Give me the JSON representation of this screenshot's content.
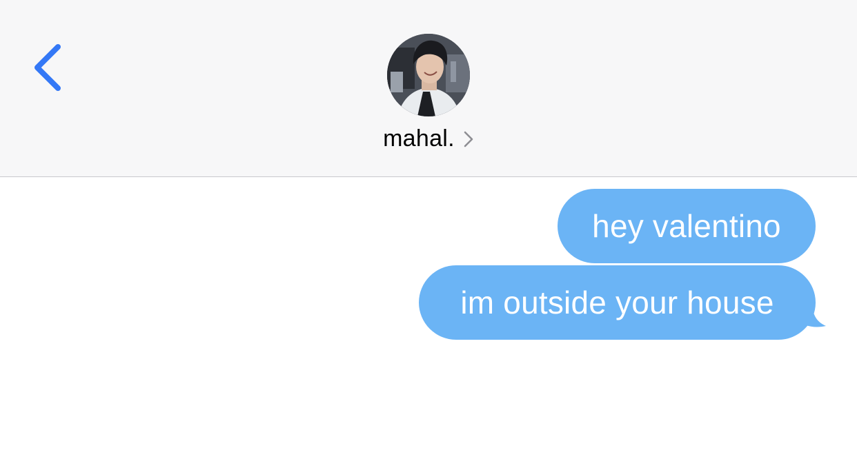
{
  "header": {
    "contact_name": "mahal.",
    "back_icon": "chevron-left-icon",
    "details_icon": "chevron-right-icon"
  },
  "messages": [
    {
      "text": "hey valentino",
      "direction": "outgoing"
    },
    {
      "text": "im outside your house",
      "direction": "outgoing"
    }
  ],
  "colors": {
    "accent": "#3478f6",
    "outgoing_bubble": "#6bb4f5",
    "header_bg": "#f7f7f8"
  }
}
